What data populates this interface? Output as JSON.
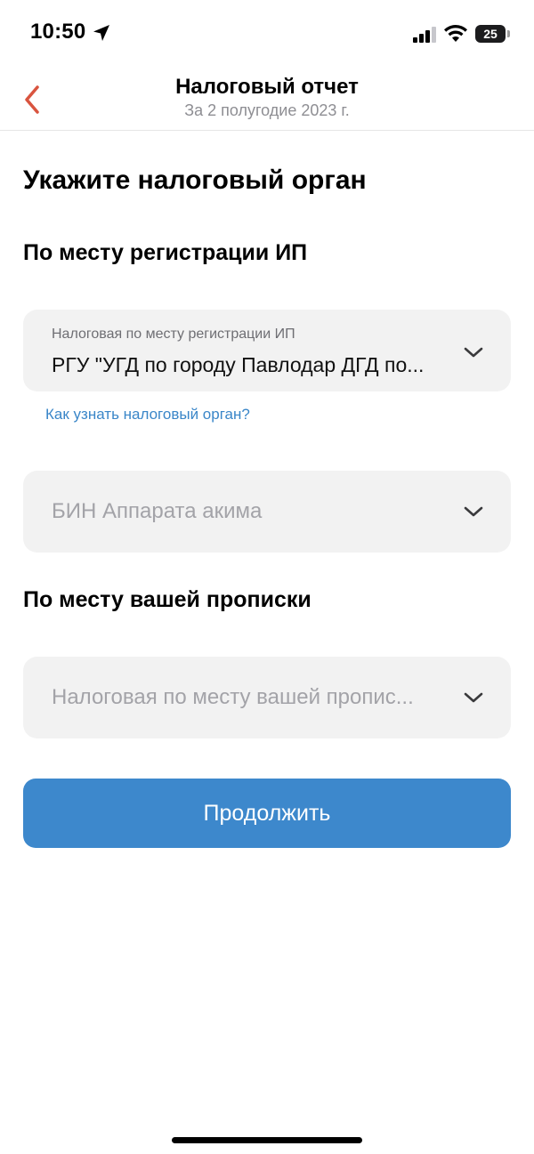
{
  "status_bar": {
    "time": "10:50",
    "battery": "25",
    "location_icon": "location-arrow-icon",
    "signal_icon": "cellular-signal-icon",
    "wifi_icon": "wifi-icon"
  },
  "header": {
    "title": "Налоговый отчет",
    "subtitle": "За 2 полугодие 2023 г.",
    "back_icon": "chevron-left-icon",
    "back_color": "#d9543f"
  },
  "main": {
    "title": "Укажите налоговый орган",
    "section_registration": {
      "title": "По месту регистрации ИП",
      "tax_office_field": {
        "label": "Налоговая по месту регистрации ИП",
        "value": "РГУ \"УГД по городу Павлодар ДГД по..."
      },
      "help_link": "Как узнать налоговый орган?",
      "akimat_field": {
        "placeholder": "БИН Аппарата акима"
      }
    },
    "section_residence": {
      "title": "По месту вашей прописки",
      "tax_office_field": {
        "placeholder": "Налоговая по месту вашей пропис..."
      }
    },
    "continue_button": "Продолжить"
  },
  "colors": {
    "accent": "#3d88cc",
    "link": "#3a86c8",
    "field_background": "#f2f2f2",
    "placeholder": "#a3a3a8"
  }
}
